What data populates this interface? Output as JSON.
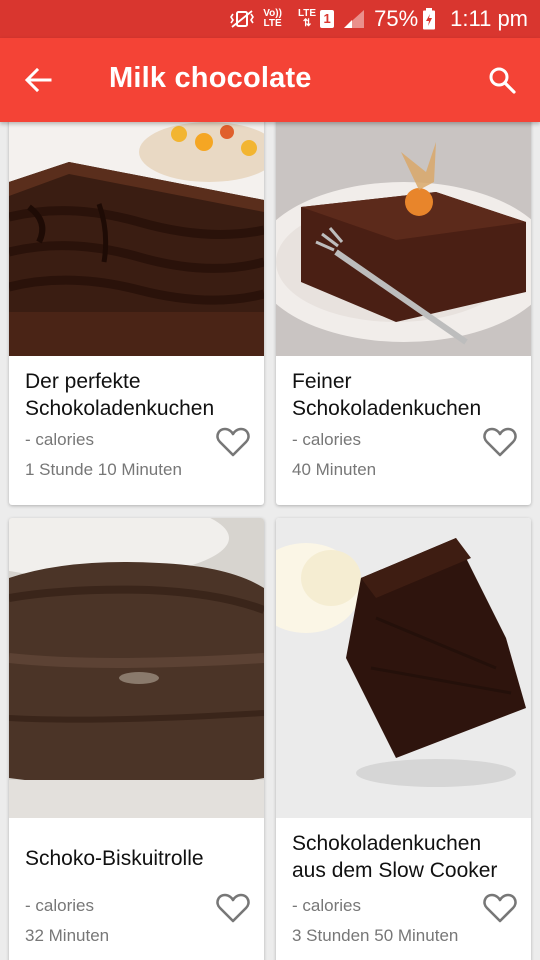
{
  "status_bar": {
    "volte": "Vo))",
    "lte_label": "LTE",
    "lte_small": "LTE",
    "sim": "1",
    "battery": "75%",
    "time": "1:11 pm"
  },
  "app_bar": {
    "title": "Milk chocolate",
    "back_icon": "arrow-back-icon",
    "search_icon": "search-icon"
  },
  "recipes": [
    {
      "title": "Der perfekte Schokoladenkuchen",
      "calories": "- calories",
      "time": "1 Stunde 10 Minuten"
    },
    {
      "title": "Feiner Schokoladenkuchen",
      "calories": "- calories",
      "time": "40 Minuten"
    },
    {
      "title": "Schoko-Biskuitrolle",
      "calories": "- calories",
      "time": "32 Minuten"
    },
    {
      "title": "Schokoladenkuchen aus dem Slow Cooker",
      "calories": "- calories",
      "time": "3 Stunden 50 Minuten"
    }
  ],
  "colors": {
    "status_bar": "#d9362f",
    "app_bar": "#f44336",
    "background": "#ececec"
  }
}
